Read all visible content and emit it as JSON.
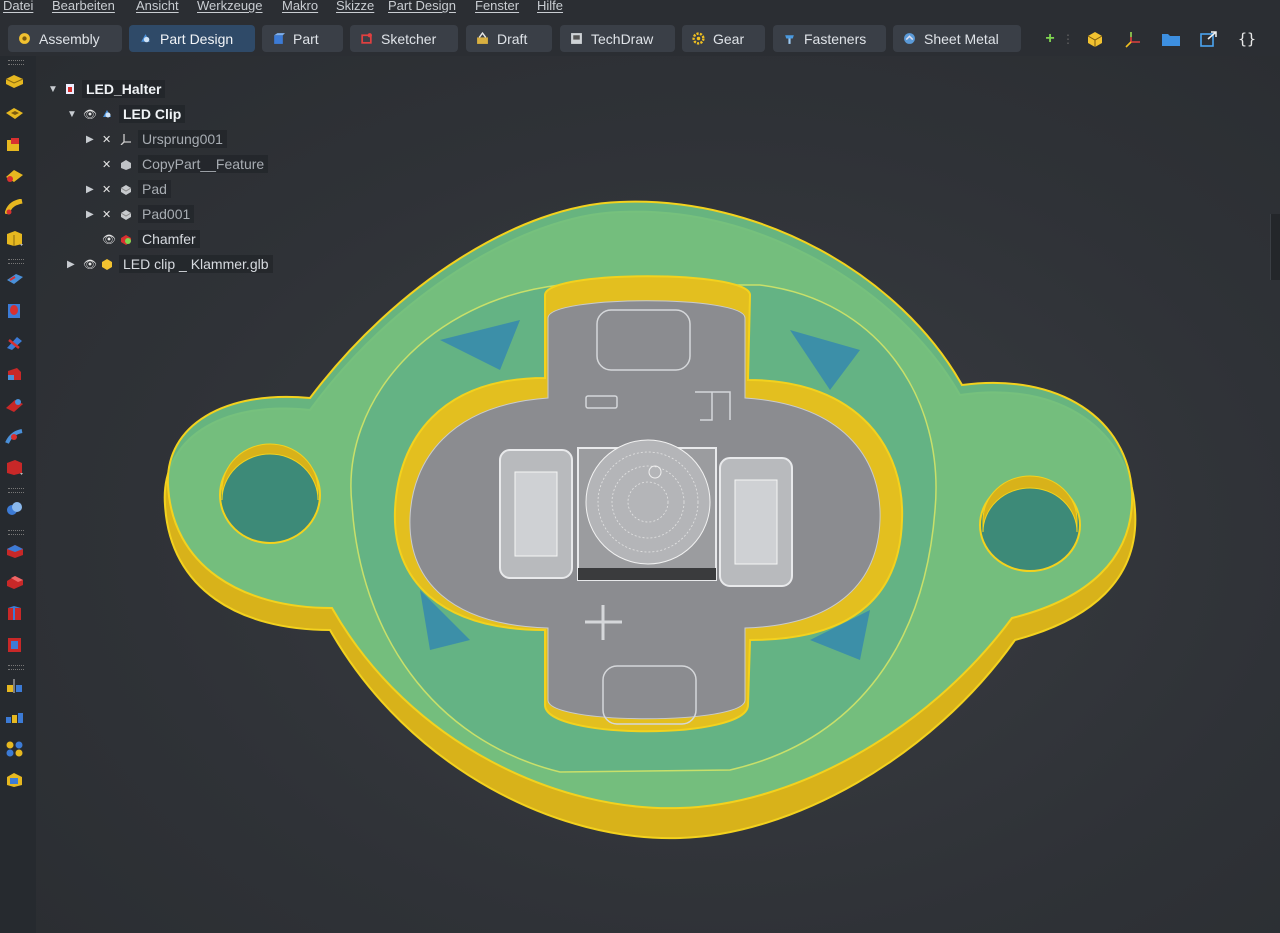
{
  "menu": [
    "Datei",
    "Bearbeiten",
    "Ansicht",
    "Werkzeuge",
    "Makro",
    "Skizze",
    "Part Design",
    "Fenster",
    "Hilfe"
  ],
  "workbenches": [
    {
      "label": "Assembly",
      "color": "#f2c230"
    },
    {
      "label": "Part Design",
      "color": "#4a90d9",
      "active": true
    },
    {
      "label": "Part",
      "color": "#3c7bd6"
    },
    {
      "label": "Sketcher",
      "color": "#e04040"
    },
    {
      "label": "Draft",
      "color": "#d9b040"
    },
    {
      "label": "TechDraw",
      "color": "#cfd3d7"
    },
    {
      "label": "Gear",
      "color": "#f0c020"
    },
    {
      "label": "Fasteners",
      "color": "#4a9ae0"
    },
    {
      "label": "Sheet Metal",
      "color": "#5a9ad8"
    }
  ],
  "toolbar_right": {
    "add_glyph": "+",
    "macro_glyph": "{}"
  },
  "tree": {
    "root": {
      "label": "LED_Halter"
    },
    "body": {
      "label": "LED Clip"
    },
    "features": [
      {
        "label": "Ursprung001",
        "icon": "origin-icon"
      },
      {
        "label": "CopyPart__Feature",
        "icon": "copy-feature-icon"
      },
      {
        "label": "Pad",
        "icon": "pad-icon"
      },
      {
        "label": "Pad001",
        "icon": "pad-icon"
      },
      {
        "label": "Chamfer",
        "icon": "chamfer-icon"
      }
    ],
    "extra": {
      "label": "LED clip _ Klammer.glb"
    }
  },
  "colors": {
    "accent": "#2f4a68",
    "solid_face": "#6bbf86",
    "solid_edge": "#f3d21e",
    "pcb": "#8b8c90"
  }
}
